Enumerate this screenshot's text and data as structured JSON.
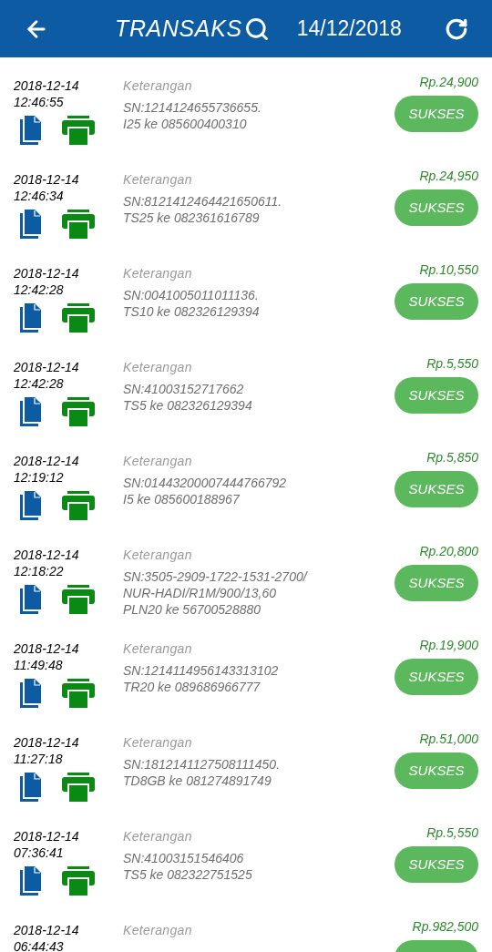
{
  "header": {
    "title": "TRANSAKS",
    "date": "14/12/2018"
  },
  "transactions": [
    {
      "date": "2018-12-14",
      "time": "12:46:55",
      "label": "Keterangan",
      "details": [
        "SN:1214124655736655.",
        "I25 ke 085600400310"
      ],
      "amount": "Rp.24,900",
      "status": "SUKSES"
    },
    {
      "date": "2018-12-14",
      "time": "12:46:34",
      "label": "Keterangan",
      "details": [
        "SN:8121412464421650611.",
        "TS25 ke 082361616789"
      ],
      "amount": "Rp.24,950",
      "status": "SUKSES"
    },
    {
      "date": "2018-12-14",
      "time": "12:42:28",
      "label": "Keterangan",
      "details": [
        "SN:0041005011011136.",
        "TS10 ke 082326129394"
      ],
      "amount": "Rp.10,550",
      "status": "SUKSES"
    },
    {
      "date": "2018-12-14",
      "time": "12:42:28",
      "label": "Keterangan",
      "details": [
        "SN:41003152717662",
        "TS5 ke 082326129394"
      ],
      "amount": "Rp.5,550",
      "status": "SUKSES"
    },
    {
      "date": "2018-12-14",
      "time": "12:19:12",
      "label": "Keterangan",
      "details": [
        "SN:01443200007444766792",
        "I5 ke 085600188967"
      ],
      "amount": "Rp.5,850",
      "status": "SUKSES"
    },
    {
      "date": "2018-12-14",
      "time": "12:18:22",
      "label": "Keterangan",
      "details": [
        "SN:3505-2909-1722-1531-2700/",
        "NUR-HADI/R1M/900/13,60",
        "PLN20 ke 56700528880"
      ],
      "amount": "Rp.20,800",
      "status": "SUKSES"
    },
    {
      "date": "2018-12-14",
      "time": "11:49:48",
      "label": "Keterangan",
      "details": [
        "SN:1214114956143313102",
        "TR20 ke 089686966777"
      ],
      "amount": "Rp.19,900",
      "status": "SUKSES"
    },
    {
      "date": "2018-12-14",
      "time": "11:27:18",
      "label": "Keterangan",
      "details": [
        "SN:1812141127508111450.",
        "TD8GB ke 081274891749"
      ],
      "amount": "Rp.51,000",
      "status": "SUKSES"
    },
    {
      "date": "2018-12-14",
      "time": "07:36:41",
      "label": "Keterangan",
      "details": [
        "SN:41003151546406",
        "TS5 ke 082322751525"
      ],
      "amount": "Rp.5,550",
      "status": "SUKSES"
    },
    {
      "date": "2018-12-14",
      "time": "06:44:43",
      "label": "Keterangan",
      "amount": "Rp.982,500"
    }
  ]
}
